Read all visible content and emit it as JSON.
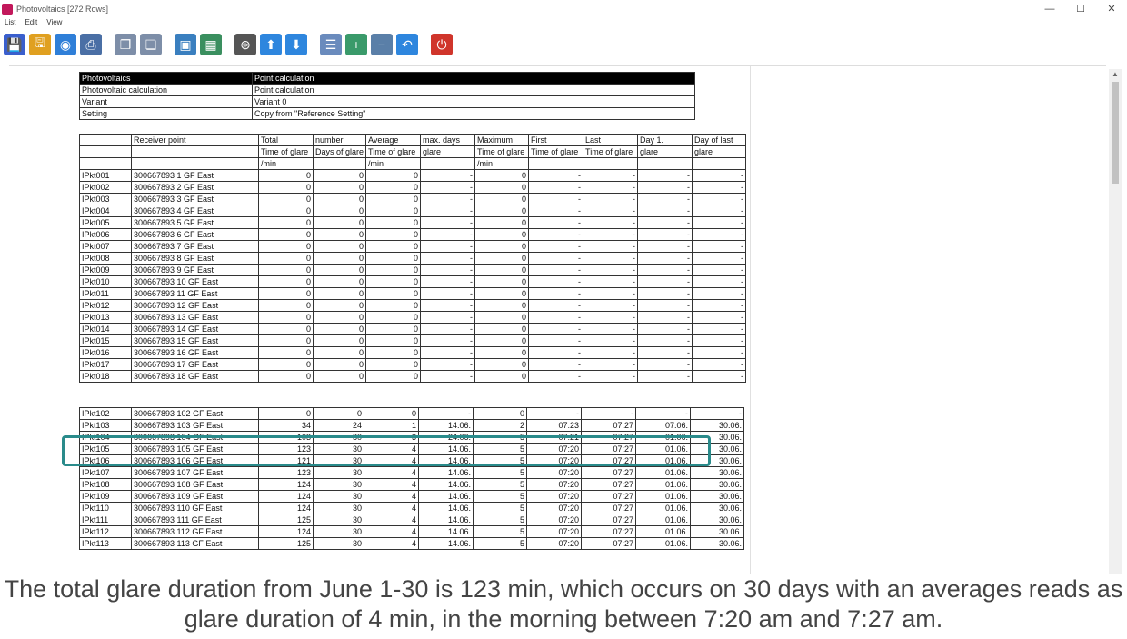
{
  "window": {
    "title": "Photovoltaics [272 Rows]",
    "controls": [
      "—",
      "☐",
      "✕"
    ]
  },
  "menu": [
    "List",
    "Edit",
    "View"
  ],
  "toolbar": [
    {
      "name": "save-icon",
      "glyph": "💾",
      "color": "#3a5fcd"
    },
    {
      "name": "print-preview-icon",
      "glyph": "🖫",
      "color": "#e0a020"
    },
    {
      "name": "globe-icon",
      "glyph": "◉",
      "color": "#2f7fd8"
    },
    {
      "name": "print-icon",
      "glyph": "⎙",
      "color": "#4a6fa5"
    },
    {
      "name": "copy-icon",
      "glyph": "❐",
      "color": "#7d8ea8"
    },
    {
      "name": "paste-icon",
      "glyph": "❏",
      "color": "#7d8ea8"
    },
    {
      "name": "export-icon",
      "glyph": "▣",
      "color": "#3a7fbf"
    },
    {
      "name": "excel-icon",
      "glyph": "▦",
      "color": "#3a8f5f"
    },
    {
      "name": "binoculars-icon",
      "glyph": "⊛",
      "color": "#555"
    },
    {
      "name": "arrow-up-icon",
      "glyph": "⬆",
      "color": "#2e86de"
    },
    {
      "name": "arrow-down-icon",
      "glyph": "⬇",
      "color": "#2e86de"
    },
    {
      "name": "list-icon",
      "glyph": "☰",
      "color": "#6a8bbd"
    },
    {
      "name": "zoom-in-icon",
      "glyph": "+",
      "color": "#3a9a6a"
    },
    {
      "name": "zoom-out-icon",
      "glyph": "−",
      "color": "#5a7fa8"
    },
    {
      "name": "undo-icon",
      "glyph": "↶",
      "color": "#2e86de"
    },
    {
      "name": "power-icon",
      "glyph": "⏻",
      "color": "#d0352b"
    }
  ],
  "info": [
    [
      "Photovoltaics",
      "Point calculation"
    ],
    [
      "Photovoltaic calculation",
      "Point calculation"
    ],
    [
      "Variant",
      "Variant 0"
    ],
    [
      "Setting",
      "Copy from \"Reference Setting\""
    ]
  ],
  "table": {
    "header1": [
      "",
      "Receiver point",
      "Total",
      "number",
      "Average",
      "max. days",
      "Maximum",
      "First",
      "Last",
      "Day 1.",
      "Day of last"
    ],
    "header2": [
      "",
      "",
      "Time of glare",
      "Days of glare",
      "Time of glare",
      "glare",
      "Time of glare",
      "Time of glare",
      "Time of glare",
      "glare",
      "glare"
    ],
    "header3": [
      "",
      "",
      "/min",
      "",
      "/min",
      "",
      "/min",
      "",
      "",
      "",
      ""
    ],
    "rows_top": [
      [
        "IPkt001",
        "300667893 1 GF East",
        "0",
        "0",
        "0",
        "-",
        "0",
        "-",
        "-",
        "-",
        "-"
      ],
      [
        "IPkt002",
        "300667893 2 GF East",
        "0",
        "0",
        "0",
        "-",
        "0",
        "-",
        "-",
        "-",
        "-"
      ],
      [
        "IPkt003",
        "300667893 3 GF East",
        "0",
        "0",
        "0",
        "-",
        "0",
        "-",
        "-",
        "-",
        "-"
      ],
      [
        "IPkt004",
        "300667893 4 GF East",
        "0",
        "0",
        "0",
        "-",
        "0",
        "-",
        "-",
        "-",
        "-"
      ],
      [
        "IPkt005",
        "300667893 5 GF East",
        "0",
        "0",
        "0",
        "-",
        "0",
        "-",
        "-",
        "-",
        "-"
      ],
      [
        "IPkt006",
        "300667893 6 GF East",
        "0",
        "0",
        "0",
        "-",
        "0",
        "-",
        "-",
        "-",
        "-"
      ],
      [
        "IPkt007",
        "300667893 7 GF East",
        "0",
        "0",
        "0",
        "-",
        "0",
        "-",
        "-",
        "-",
        "-"
      ],
      [
        "IPkt008",
        "300667893 8 GF East",
        "0",
        "0",
        "0",
        "-",
        "0",
        "-",
        "-",
        "-",
        "-"
      ],
      [
        "IPkt009",
        "300667893 9 GF East",
        "0",
        "0",
        "0",
        "-",
        "0",
        "-",
        "-",
        "-",
        "-"
      ],
      [
        "IPkt010",
        "300667893 10 GF East",
        "0",
        "0",
        "0",
        "-",
        "0",
        "-",
        "-",
        "-",
        "-"
      ],
      [
        "IPkt011",
        "300667893 11 GF East",
        "0",
        "0",
        "0",
        "-",
        "0",
        "-",
        "-",
        "-",
        "-"
      ],
      [
        "IPkt012",
        "300667893 12 GF East",
        "0",
        "0",
        "0",
        "-",
        "0",
        "-",
        "-",
        "-",
        "-"
      ],
      [
        "IPkt013",
        "300667893 13 GF East",
        "0",
        "0",
        "0",
        "-",
        "0",
        "-",
        "-",
        "-",
        "-"
      ],
      [
        "IPkt014",
        "300667893 14 GF East",
        "0",
        "0",
        "0",
        "-",
        "0",
        "-",
        "-",
        "-",
        "-"
      ],
      [
        "IPkt015",
        "300667893 15 GF East",
        "0",
        "0",
        "0",
        "-",
        "0",
        "-",
        "-",
        "-",
        "-"
      ],
      [
        "IPkt016",
        "300667893 16 GF East",
        "0",
        "0",
        "0",
        "-",
        "0",
        "-",
        "-",
        "-",
        "-"
      ],
      [
        "IPkt017",
        "300667893 17 GF East",
        "0",
        "0",
        "0",
        "-",
        "0",
        "-",
        "-",
        "-",
        "-"
      ],
      [
        "IPkt018",
        "300667893 18 GF East",
        "0",
        "0",
        "0",
        "-",
        "0",
        "-",
        "-",
        "-",
        "-"
      ]
    ],
    "rows_bottom": [
      [
        "IPkt102",
        "300667893 102 GF East",
        "0",
        "0",
        "0",
        "-",
        "0",
        "-",
        "-",
        "-",
        "-"
      ],
      [
        "IPkt103",
        "300667893 103 GF East",
        "34",
        "24",
        "1",
        "14.06.",
        "2",
        "07:23",
        "07:27",
        "07.06.",
        "30.06."
      ],
      [
        "IPkt104",
        "300667893 104 GF East",
        "103",
        "30",
        "3",
        "24.06.",
        "5",
        "07:21",
        "07:27",
        "01.06.",
        "30.06."
      ],
      [
        "IPkt105",
        "300667893 105 GF East",
        "123",
        "30",
        "4",
        "14.06.",
        "5",
        "07:20",
        "07:27",
        "01.06.",
        "30.06."
      ],
      [
        "IPkt106",
        "300667893 106 GF East",
        "121",
        "30",
        "4",
        "14.06.",
        "5",
        "07:20",
        "07:27",
        "01.06.",
        "30.06."
      ],
      [
        "IPkt107",
        "300667893 107 GF East",
        "123",
        "30",
        "4",
        "14.06.",
        "5",
        "07:20",
        "07:27",
        "01.06.",
        "30.06."
      ],
      [
        "IPkt108",
        "300667893 108 GF East",
        "124",
        "30",
        "4",
        "14.06.",
        "5",
        "07:20",
        "07:27",
        "01.06.",
        "30.06."
      ],
      [
        "IPkt109",
        "300667893 109 GF East",
        "124",
        "30",
        "4",
        "14.06.",
        "5",
        "07:20",
        "07:27",
        "01.06.",
        "30.06."
      ],
      [
        "IPkt110",
        "300667893 110 GF East",
        "124",
        "30",
        "4",
        "14.06.",
        "5",
        "07:20",
        "07:27",
        "01.06.",
        "30.06."
      ],
      [
        "IPkt111",
        "300667893 111 GF East",
        "125",
        "30",
        "4",
        "14.06.",
        "5",
        "07:20",
        "07:27",
        "01.06.",
        "30.06."
      ],
      [
        "IPkt112",
        "300667893 112 GF East",
        "124",
        "30",
        "4",
        "14.06.",
        "5",
        "07:20",
        "07:27",
        "01.06.",
        "30.06."
      ],
      [
        "IPkt113",
        "300667893 113 GF East",
        "125",
        "30",
        "4",
        "14.06.",
        "5",
        "07:20",
        "07:27",
        "01.06.",
        "30.06."
      ]
    ]
  },
  "caption": {
    "line1": "The total glare duration from June 1-30 is 123 min, which occurs on 30 days with an averages reads as",
    "line2": "glare duration of 4 min, in the morning between 7:20 am and 7:27 am."
  },
  "colors": {
    "highlight": "#2a8b8b"
  }
}
